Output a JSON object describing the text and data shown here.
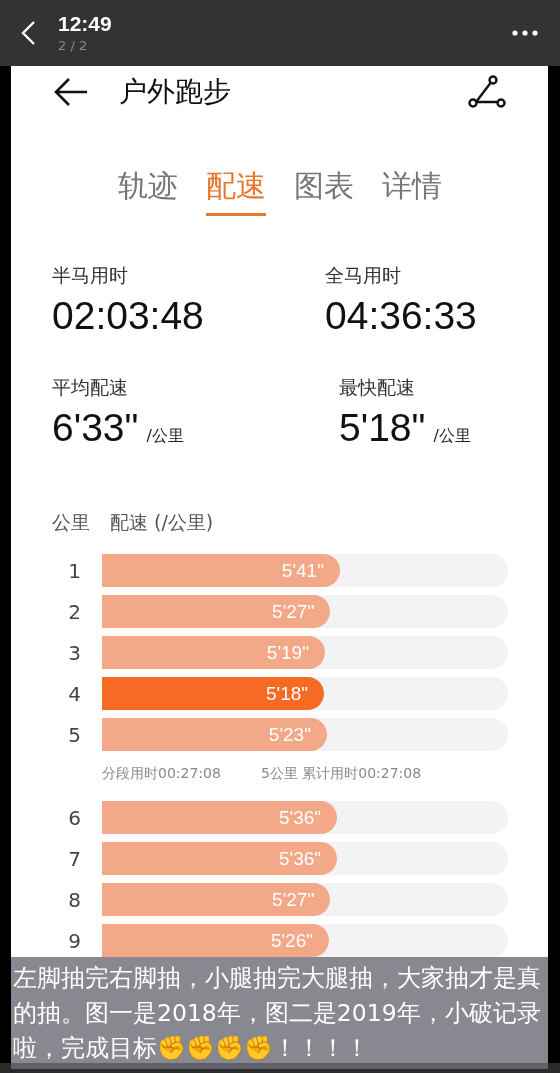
{
  "viewer": {
    "time": "12:49",
    "counter": "2 / 2"
  },
  "header": {
    "title": "户外跑步"
  },
  "tabs": [
    {
      "label": "轨迹",
      "selected": false
    },
    {
      "label": "配速",
      "selected": true
    },
    {
      "label": "图表",
      "selected": false
    },
    {
      "label": "详情",
      "selected": false
    }
  ],
  "summary": [
    {
      "label": "半马用时",
      "value": "02:03:48"
    },
    {
      "label": "全马用时",
      "value": "04:36:33"
    },
    {
      "label": "平均配速",
      "value": "6'33\"",
      "unit": "/公里"
    },
    {
      "label": "最快配速",
      "value": "5'18\"",
      "unit": "/公里"
    }
  ],
  "table": {
    "columns": [
      "公里",
      "配速 (/公里)"
    ],
    "groups": [
      {
        "rows": [
          {
            "km": "1",
            "pace": "5'41\"",
            "level": 0.586,
            "selected": false
          },
          {
            "km": "2",
            "pace": "5'27\"",
            "level": 0.562,
            "selected": false
          },
          {
            "km": "3",
            "pace": "5'19\"",
            "level": 0.549,
            "selected": false
          },
          {
            "km": "4",
            "pace": "5'18\"",
            "level": 0.547,
            "selected": true
          },
          {
            "km": "5",
            "pace": "5'23\"",
            "level": 0.554,
            "selected": false
          }
        ],
        "split": {
          "segment_time": "分段用时00:27:08",
          "cumulative": "5公里 累计用时00:27:08"
        }
      },
      {
        "rows": [
          {
            "km": "6",
            "pace": "5'36\"",
            "level": 0.579,
            "selected": false
          },
          {
            "km": "7",
            "pace": "5'36\"",
            "level": 0.579,
            "selected": false
          },
          {
            "km": "8",
            "pace": "5'27\"",
            "level": 0.562,
            "selected": false
          },
          {
            "km": "9",
            "pace": "5'26\"",
            "level": 0.559,
            "selected": false
          }
        ]
      }
    ]
  },
  "caption": "左脚抽完右脚抽，小腿抽完大腿抽，大家抽才是真的抽。图一是2018年，图二是2019年，小破记录啦，完成目标✊✊✊✊！！！！"
}
